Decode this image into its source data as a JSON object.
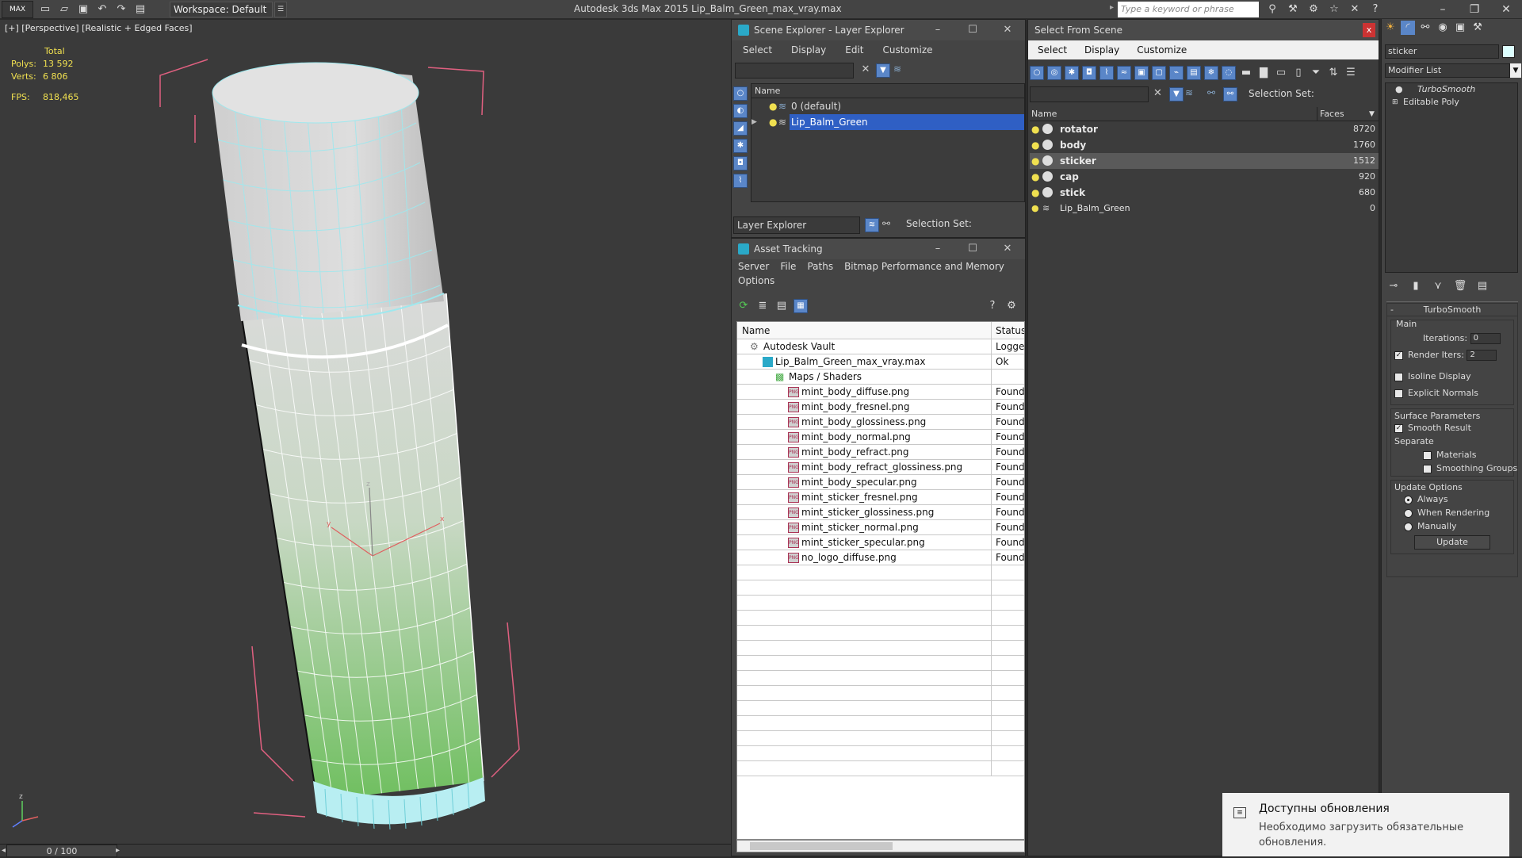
{
  "app": {
    "logo": "MAX",
    "workspace": "Workspace: Default",
    "title": "Autodesk 3ds Max  2015    Lip_Balm_Green_max_vray.max",
    "search_placeholder": "Type a keyword or phrase"
  },
  "viewport": {
    "label": "[+] [Perspective] [Realistic + Edged Faces]",
    "stats": {
      "total_label": "Total",
      "polys_label": "Polys:",
      "polys": "13 592",
      "verts_label": "Verts:",
      "verts": "6 806",
      "fps_label": "FPS:",
      "fps": "818,465"
    },
    "axis_labels": {
      "z": "z",
      "y": "y",
      "x": "x"
    },
    "frame_counter": "0 / 100"
  },
  "scene_explorer": {
    "title": "Scene Explorer - Layer Explorer",
    "menu": [
      "Select",
      "Display",
      "Edit",
      "Customize"
    ],
    "col_name": "Name",
    "layers": [
      {
        "name": "0 (default)",
        "selected": false
      },
      {
        "name": "Lip_Balm_Green",
        "selected": true
      }
    ],
    "footer_explorer": "Layer Explorer",
    "footer_selection": "Selection Set:"
  },
  "asset_tracking": {
    "title": "Asset Tracking",
    "menu": [
      "Server",
      "File",
      "Paths",
      "Bitmap Performance and Memory"
    ],
    "menu2": "Options",
    "col_name": "Name",
    "col_status": "Status",
    "rows": [
      {
        "name": "Autodesk Vault",
        "status": "Logged",
        "indent": 1,
        "icon": "vault"
      },
      {
        "name": "Lip_Balm_Green_max_vray.max",
        "status": "Ok",
        "indent": 2,
        "icon": "max"
      },
      {
        "name": "Maps / Shaders",
        "status": "",
        "indent": 3,
        "icon": "maps"
      },
      {
        "name": "mint_body_diffuse.png",
        "status": "Found",
        "indent": 4,
        "icon": "png"
      },
      {
        "name": "mint_body_fresnel.png",
        "status": "Found",
        "indent": 4,
        "icon": "png"
      },
      {
        "name": "mint_body_glossiness.png",
        "status": "Found",
        "indent": 4,
        "icon": "png"
      },
      {
        "name": "mint_body_normal.png",
        "status": "Found",
        "indent": 4,
        "icon": "png"
      },
      {
        "name": "mint_body_refract.png",
        "status": "Found",
        "indent": 4,
        "icon": "png"
      },
      {
        "name": "mint_body_refract_glossiness.png",
        "status": "Found",
        "indent": 4,
        "icon": "png"
      },
      {
        "name": "mint_body_specular.png",
        "status": "Found",
        "indent": 4,
        "icon": "png"
      },
      {
        "name": "mint_sticker_fresnel.png",
        "status": "Found",
        "indent": 4,
        "icon": "png"
      },
      {
        "name": "mint_sticker_glossiness.png",
        "status": "Found",
        "indent": 4,
        "icon": "png"
      },
      {
        "name": "mint_sticker_normal.png",
        "status": "Found",
        "indent": 4,
        "icon": "png"
      },
      {
        "name": "mint_sticker_specular.png",
        "status": "Found",
        "indent": 4,
        "icon": "png"
      },
      {
        "name": "no_logo_diffuse.png",
        "status": "Found",
        "indent": 4,
        "icon": "png"
      }
    ],
    "png_icon_text": "PNG"
  },
  "select_from_scene": {
    "title": "Select From Scene",
    "close": "x",
    "menu": [
      "Select",
      "Display",
      "Customize"
    ],
    "selection_set": "Selection Set:",
    "col_name": "Name",
    "col_faces": "Faces",
    "objects": [
      {
        "name": "rotator",
        "faces": "8720",
        "selected": false
      },
      {
        "name": "body",
        "faces": "1760",
        "selected": false
      },
      {
        "name": "sticker",
        "faces": "1512",
        "selected": true
      },
      {
        "name": "cap",
        "faces": "920",
        "selected": false
      },
      {
        "name": "stick",
        "faces": "680",
        "selected": false
      },
      {
        "name": "Lip_Balm_Green",
        "faces": "0",
        "selected": false,
        "layer": true
      }
    ]
  },
  "command_panel": {
    "object_name": "sticker",
    "modifier_list": "Modifier List",
    "stack": [
      "TurboSmooth",
      "Editable Poly"
    ],
    "rollout_title": "TurboSmooth",
    "main_label": "Main",
    "iterations_label": "Iterations:",
    "iterations": "0",
    "render_iters_label": "Render Iters:",
    "render_iters": "2",
    "render_iters_checked": true,
    "isoline": "Isoline Display",
    "explicit_normals": "Explicit Normals",
    "surface_params": "Surface Parameters",
    "smooth_result": "Smooth Result",
    "separate": "Separate",
    "materials": "Materials",
    "smoothing_groups": "Smoothing Groups",
    "update_options": "Update Options",
    "always": "Always",
    "when_rendering": "When Rendering",
    "manually": "Manually",
    "update_button": "Update",
    "minus": "-"
  },
  "notification": {
    "title": "Доступны обновления",
    "body": "Необходимо загрузить обязательные обновления."
  },
  "colors": {
    "selection_blue": "#2f5fc4",
    "stats_yellow": "#f0e050",
    "bottle_green": "#6fbf5f",
    "wire": "#9fe8ee",
    "bbox": "#e06080"
  }
}
